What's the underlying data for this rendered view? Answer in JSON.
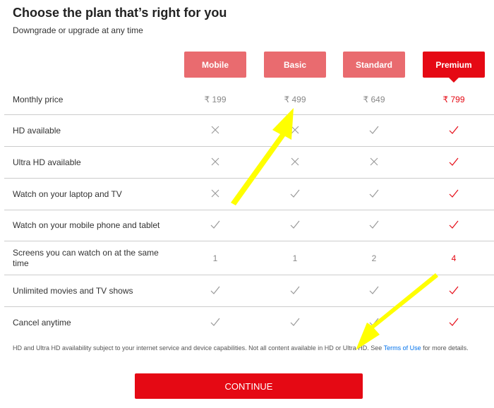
{
  "title": "Choose the plan that’s right for you",
  "subtitle": "Downgrade or upgrade at any time",
  "plans": [
    "Mobile",
    "Basic",
    "Standard",
    "Premium"
  ],
  "selected_plan": "Premium",
  "rows": [
    {
      "label": "Monthly price",
      "values": [
        "₹ 199",
        "₹ 499",
        "₹ 649",
        "₹ 799"
      ]
    },
    {
      "label": "HD available",
      "values": [
        "no",
        "no",
        "yes",
        "yes"
      ]
    },
    {
      "label": "Ultra HD available",
      "values": [
        "no",
        "no",
        "no",
        "yes"
      ]
    },
    {
      "label": "Watch on your laptop and TV",
      "values": [
        "no",
        "yes",
        "yes",
        "yes"
      ]
    },
    {
      "label": "Watch on your mobile phone and tablet",
      "values": [
        "yes",
        "yes",
        "yes",
        "yes"
      ]
    },
    {
      "label": "Screens you can watch on at the same time",
      "values": [
        "1",
        "1",
        "2",
        "4"
      ]
    },
    {
      "label": "Unlimited movies and TV shows",
      "values": [
        "yes",
        "yes",
        "yes",
        "yes"
      ]
    },
    {
      "label": "Cancel anytime",
      "values": [
        "yes",
        "yes",
        "yes",
        "yes"
      ]
    }
  ],
  "note": {
    "text": "HD and Ultra HD availability subject to your internet service and device capabilities. Not all content available in HD or Ultra HD. See ",
    "link": "Terms of Use",
    "after": " for more details."
  },
  "continue_label": "CONTINUE",
  "colors": {
    "accent": "#e50914",
    "plan_unselected": "#e96b6f",
    "annotation_arrow": "#ffff00"
  }
}
